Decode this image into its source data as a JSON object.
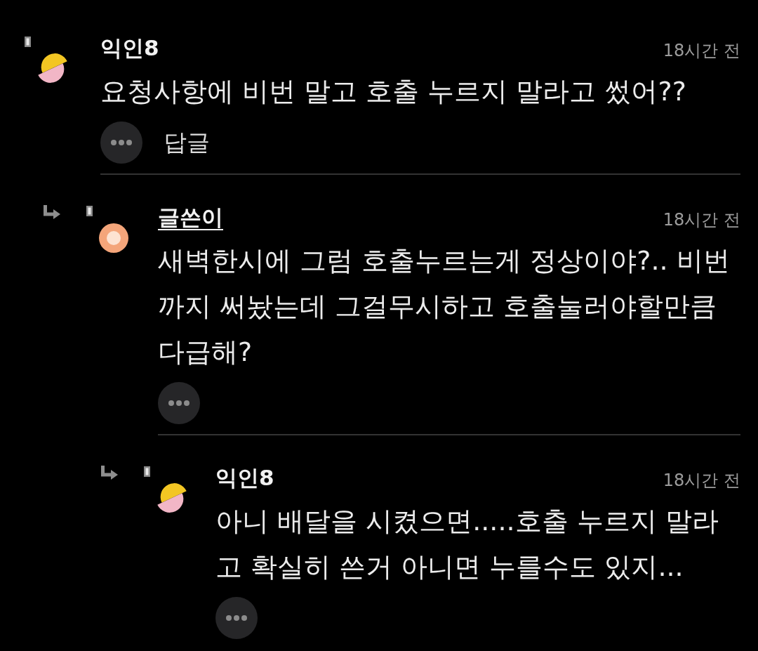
{
  "comments": [
    {
      "kind": "anonymous",
      "author": "익인8",
      "time": "18시간 전",
      "body": "요청사항에 비번 말고 호출 누르지 말라고 썼어??",
      "reply_label": "답글",
      "children": [
        {
          "kind": "writer",
          "author": "글쓴이",
          "time": "18시간 전",
          "body": "새벽한시에 그럼 호출누르는게 정상이야?.. 비번까지 써놨는데 그걸무시하고 호출눌러야할만큼 다급해?",
          "children": [
            {
              "kind": "anonymous",
              "author": "익인8",
              "time": "18시간 전",
              "body": "아니 배달을 시켰으면.....호출 누르지 말라고 확실히 쓴거 아니면 누를수도 있지..."
            }
          ]
        }
      ]
    }
  ]
}
